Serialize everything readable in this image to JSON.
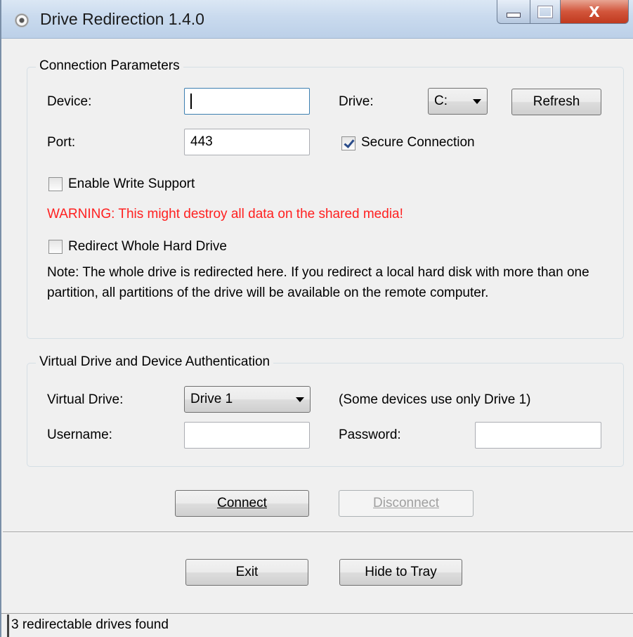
{
  "window": {
    "title": "Drive Redirection 1.4.0",
    "close_glyph": "X"
  },
  "connection": {
    "legend": "Connection Parameters",
    "device_label": "Device:",
    "device_value": "",
    "drive_label": "Drive:",
    "drive_selected": "C:",
    "refresh_label": "Refresh",
    "port_label": "Port:",
    "port_value": "443",
    "secure_label": "Secure Connection",
    "secure_checked": true,
    "write_label": "Enable Write Support",
    "write_checked": false,
    "warning": "WARNING: This might destroy all data on the shared media!",
    "whole_drive_label": "Redirect Whole Hard Drive",
    "whole_drive_checked": false,
    "note": "Note: The whole drive is redirected here. If you redirect a local hard disk with more than one partition, all partitions of the drive will be available on the remote computer."
  },
  "virtual": {
    "legend": "Virtual Drive and Device Authentication",
    "drive_label": "Virtual Drive:",
    "drive_selected": "Drive 1",
    "drive_hint": "(Some devices use only Drive 1)",
    "username_label": "Username:",
    "username_value": "",
    "password_label": "Password:",
    "password_value": ""
  },
  "actions": {
    "connect_label": "Connect",
    "disconnect_label": "Disconnect",
    "exit_label": "Exit",
    "hide_label": "Hide to Tray"
  },
  "status": {
    "text": "3 redirectable drives found"
  },
  "colors": {
    "warning": "#ff2020",
    "titlebar": "#c9daee",
    "close_button": "#c03a1f"
  }
}
